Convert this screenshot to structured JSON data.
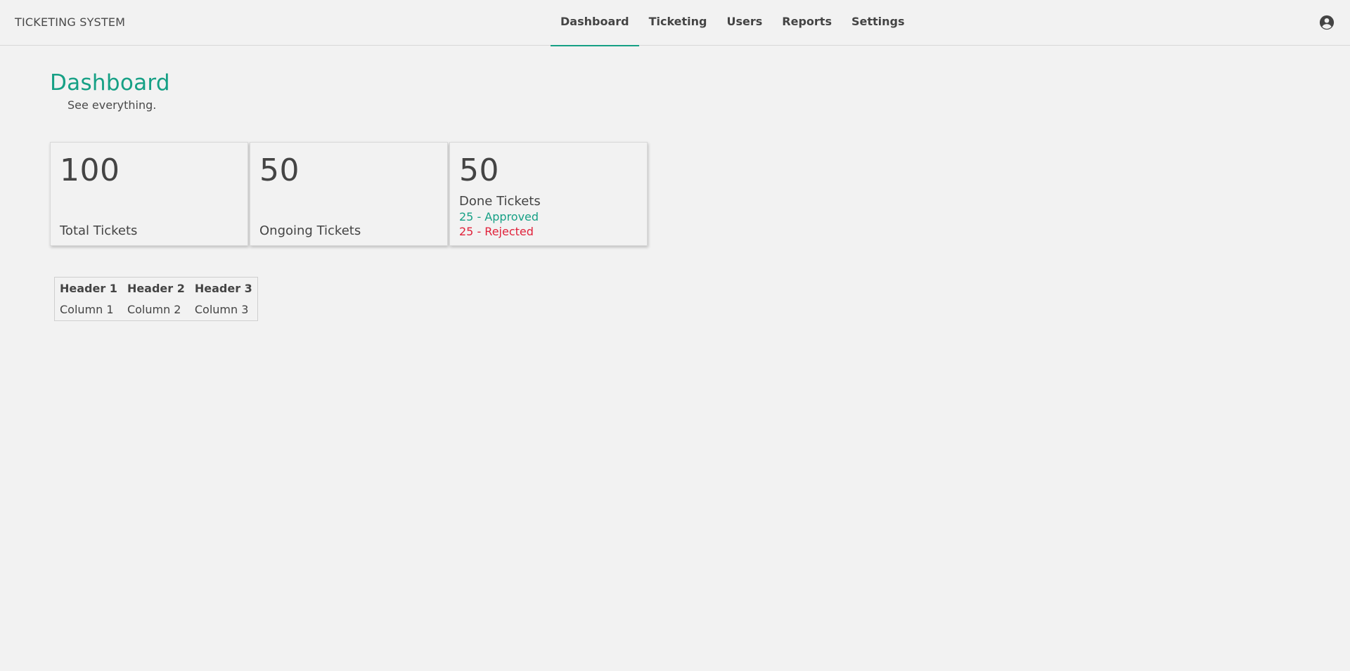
{
  "app": {
    "brand": "TICKETING SYSTEM",
    "user_icon": "account-circle-icon"
  },
  "nav": {
    "items": [
      {
        "label": "Dashboard",
        "active": true
      },
      {
        "label": "Ticketing",
        "active": false
      },
      {
        "label": "Users",
        "active": false
      },
      {
        "label": "Reports",
        "active": false
      },
      {
        "label": "Settings",
        "active": false
      }
    ]
  },
  "page": {
    "title": "Dashboard",
    "subtitle": "See everything."
  },
  "cards": {
    "total": {
      "value": "100",
      "label": "Total Tickets"
    },
    "ongoing": {
      "value": "50",
      "label": "Ongoing Tickets"
    },
    "done": {
      "value": "50",
      "label": "Done Tickets",
      "approved": "25 - Approved",
      "rejected": "25 - Rejected"
    }
  },
  "table": {
    "headers": [
      "Header 1",
      "Header 2",
      "Header 3"
    ],
    "rows": [
      [
        "Column 1",
        "Column 2",
        "Column 3"
      ]
    ]
  },
  "colors": {
    "accent": "#16a085",
    "rejected": "#e0213a",
    "text": "#444444",
    "background": "#f2f2f2"
  }
}
